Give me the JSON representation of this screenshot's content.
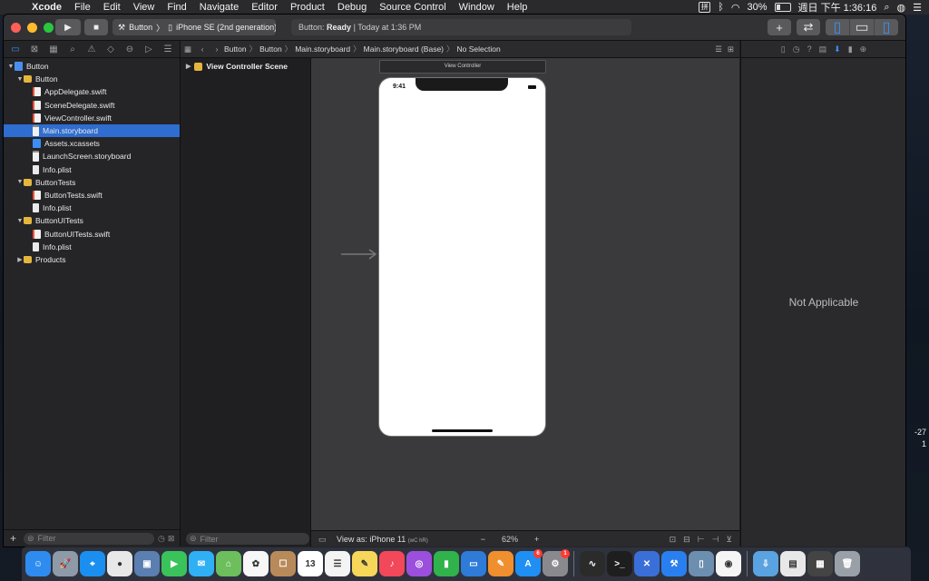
{
  "menubar": {
    "app_name": "Xcode",
    "items": [
      "File",
      "Edit",
      "View",
      "Find",
      "Navigate",
      "Editor",
      "Product",
      "Debug",
      "Source Control",
      "Window",
      "Help"
    ],
    "input_method": "拼",
    "battery": "30%",
    "clock": "週日 下午 1:36:16"
  },
  "toolbar": {
    "scheme_project": "Button",
    "scheme_device": "iPhone SE (2nd generation)",
    "status_label": "Button:",
    "status_state": "Ready",
    "status_time": "| Today at 1:36 PM"
  },
  "navigator": {
    "tree": [
      {
        "label": "Button",
        "type": "proj",
        "depth": 0,
        "expanded": true,
        "selected": false
      },
      {
        "label": "Button",
        "type": "folder",
        "depth": 1,
        "expanded": true,
        "selected": false
      },
      {
        "label": "AppDelegate.swift",
        "type": "swift",
        "depth": 2,
        "selected": false
      },
      {
        "label": "SceneDelegate.swift",
        "type": "swift",
        "depth": 2,
        "selected": false
      },
      {
        "label": "ViewController.swift",
        "type": "swift",
        "depth": 2,
        "selected": false
      },
      {
        "label": "Main.storyboard",
        "type": "sb",
        "depth": 2,
        "selected": true
      },
      {
        "label": "Assets.xcassets",
        "type": "assets",
        "depth": 2,
        "selected": false
      },
      {
        "label": "LaunchScreen.storyboard",
        "type": "sb",
        "depth": 2,
        "selected": false
      },
      {
        "label": "Info.plist",
        "type": "file",
        "depth": 2,
        "selected": false
      },
      {
        "label": "ButtonTests",
        "type": "folder",
        "depth": 1,
        "expanded": true,
        "selected": false
      },
      {
        "label": "ButtonTests.swift",
        "type": "swift",
        "depth": 2,
        "selected": false
      },
      {
        "label": "Info.plist",
        "type": "file",
        "depth": 2,
        "selected": false
      },
      {
        "label": "ButtonUITests",
        "type": "folder",
        "depth": 1,
        "expanded": true,
        "selected": false
      },
      {
        "label": "ButtonUITests.swift",
        "type": "swift",
        "depth": 2,
        "selected": false
      },
      {
        "label": "Info.plist",
        "type": "file",
        "depth": 2,
        "selected": false
      },
      {
        "label": "Products",
        "type": "folder",
        "depth": 1,
        "expanded": false,
        "selected": false
      }
    ],
    "filter_placeholder": "Filter"
  },
  "jumpbar": {
    "crumbs": [
      "Button",
      "Button",
      "Main.storyboard",
      "Main.storyboard (Base)",
      "No Selection"
    ]
  },
  "outline": {
    "scene_label": "View Controller Scene",
    "filter_placeholder": "Filter"
  },
  "canvas": {
    "vc_title": "View Controller",
    "phone_time": "9:41"
  },
  "bottombar": {
    "view_as": "View as: iPhone 11",
    "traits": "(wC hR)",
    "zoom": "62%"
  },
  "inspector": {
    "empty_text": "Not Applicable"
  },
  "desktop": {
    "side_text_1": "-27",
    "side_text_2": "1"
  },
  "dock": {
    "apps": [
      {
        "name": "Finder",
        "color": "#2e8cf0",
        "glyph": "☺"
      },
      {
        "name": "Launchpad",
        "color": "#8e9aa8",
        "glyph": "🚀"
      },
      {
        "name": "Safari",
        "color": "#1b8ff0",
        "glyph": "⌖"
      },
      {
        "name": "Chrome",
        "color": "#e8e8e8",
        "glyph": "●"
      },
      {
        "name": "Preview",
        "color": "#5a7fb0",
        "glyph": "▣"
      },
      {
        "name": "FaceTime",
        "color": "#3ac35a",
        "glyph": "▶"
      },
      {
        "name": "Messages",
        "color": "#2fb0f5",
        "glyph": "✉"
      },
      {
        "name": "Maps",
        "color": "#6cbf5c",
        "glyph": "⌂"
      },
      {
        "name": "Photos",
        "color": "#f7f7f7",
        "glyph": "✿"
      },
      {
        "name": "Contacts",
        "color": "#b88a5a",
        "glyph": "☐"
      },
      {
        "name": "Calendar",
        "color": "#ffffff",
        "glyph": "13"
      },
      {
        "name": "Reminders",
        "color": "#f4f4f4",
        "glyph": "☰"
      },
      {
        "name": "Notes",
        "color": "#f6d75a",
        "glyph": "✎"
      },
      {
        "name": "Music",
        "color": "#f2485a",
        "glyph": "♪"
      },
      {
        "name": "Podcasts",
        "color": "#9b4fdc",
        "glyph": "◎"
      },
      {
        "name": "Numbers",
        "color": "#2fb34a",
        "glyph": "▮"
      },
      {
        "name": "Keynote",
        "color": "#2e7bd8",
        "glyph": "▭"
      },
      {
        "name": "Pages",
        "color": "#f08f2e",
        "glyph": "✎"
      },
      {
        "name": "App Store",
        "color": "#1f8ff4",
        "glyph": "A",
        "badge": "6"
      },
      {
        "name": "System Preferences",
        "color": "#8a8a8e",
        "glyph": "⚙",
        "badge": "1"
      },
      {
        "name": "Activity Monitor",
        "color": "#2b2b2b",
        "glyph": "∿"
      },
      {
        "name": "Terminal",
        "color": "#1e1e1e",
        "glyph": ">_"
      },
      {
        "name": "Xcode Instruments",
        "color": "#3a6fd8",
        "glyph": "✕"
      },
      {
        "name": "Xcode",
        "color": "#2a7ff0",
        "glyph": "⚒"
      },
      {
        "name": "Simulator",
        "color": "#6c8fb0",
        "glyph": "▯"
      },
      {
        "name": "Color Picker",
        "color": "#f5f5f5",
        "glyph": "◉"
      },
      {
        "name": "Downloads",
        "color": "#5aa3e0",
        "glyph": "⇩"
      },
      {
        "name": "Documents",
        "color": "#e8e8e8",
        "glyph": "▤"
      },
      {
        "name": "Folder",
        "color": "#444",
        "glyph": "▦"
      },
      {
        "name": "Trash",
        "color": "#9aa0a8",
        "glyph": "🗑"
      }
    ]
  }
}
